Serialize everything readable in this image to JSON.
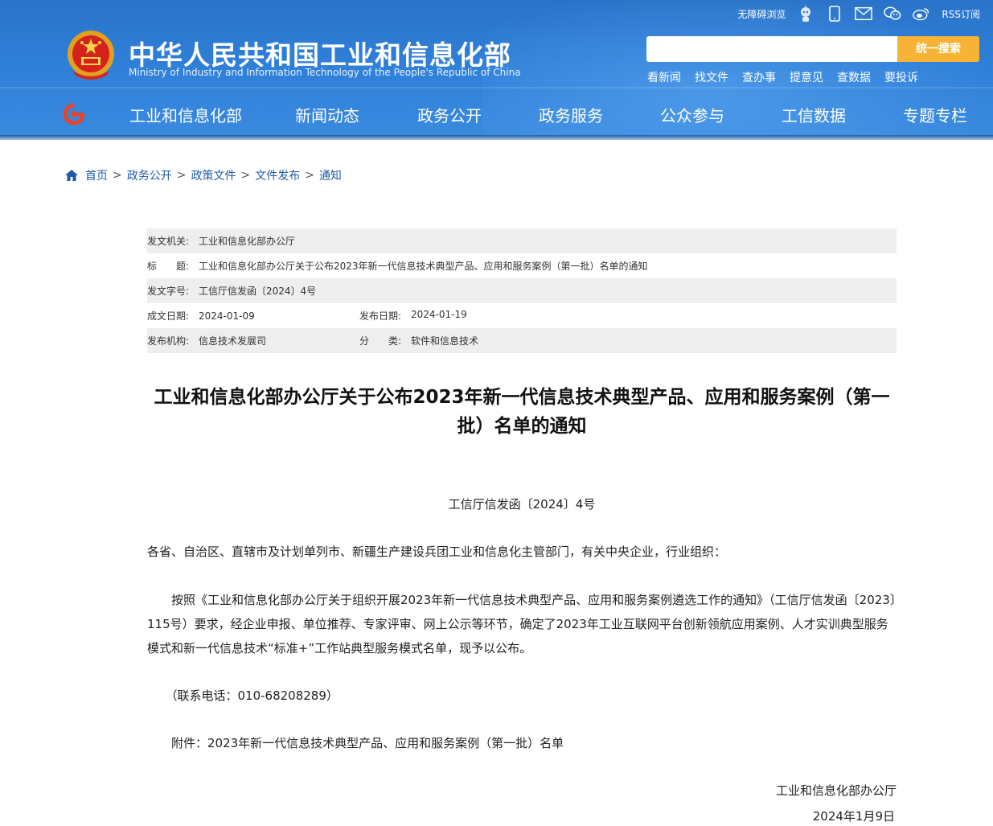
{
  "header": {
    "title": "中华人民共和国工业和信息化部",
    "subtitle": "Ministry of Industry and Information Technology of the People's Republic of China",
    "topbar": {
      "accessibility": "无障碍浏览",
      "rss": "RSS订阅"
    },
    "search": {
      "placeholder": "",
      "button": "统一搜索"
    },
    "quick_links": [
      "看新闻",
      "找文件",
      "查办事",
      "提意见",
      "查数据",
      "要投诉"
    ],
    "nav": [
      "工业和信息化部",
      "新闻动态",
      "政务公开",
      "政务服务",
      "公众参与",
      "工信数据",
      "专题专栏"
    ],
    "colors": {
      "header_blue": "#2f7fd8",
      "search_orange": "#f6b335",
      "link_blue": "#1e5aa8"
    }
  },
  "breadcrumb": [
    "首页",
    "政务公开",
    "政策文件",
    "文件发布",
    "通知"
  ],
  "meta": {
    "issuer_label": "发文机关:",
    "issuer": "工业和信息化部办公厅",
    "title_label": "标　　题:",
    "title": "工业和信息化部办公厅关于公布2023年新一代信息技术典型产品、应用和服务案例（第一批）名单的通知",
    "docno_label": "发文字号:",
    "docno": "工信厅信发函〔2024〕4号",
    "written_label": "成文日期:",
    "written": "2024-01-09",
    "published_label": "发布日期:",
    "published": "2024-01-19",
    "org_label": "发布机构:",
    "org": "信息技术发展司",
    "category_label": "分　　类:",
    "category": "软件和信息技术"
  },
  "article": {
    "title": "工业和信息化部办公厅关于公布2023年新一代信息技术典型产品、应用和服务案例（第一批）名单的通知",
    "doc_number": "工信厅信发函〔2024〕4号",
    "salutation": "各省、自治区、直辖市及计划单列市、新疆生产建设兵团工业和信息化主管部门，有关中央企业，行业组织：",
    "body": "　　按照《工业和信息化部办公厅关于组织开展2023年新一代信息技术典型产品、应用和服务案例遴选工作的通知》（工信厅信发函〔2023〕115号）要求，经企业申报、单位推荐、专家评审、网上公示等环节，确定了2023年工业互联网平台创新领航应用案例、人才实训典型服务模式和新一代信息技术“标准+”工作站典型服务模式名单，现予以公布。",
    "contact": "　　（联系电话：010-68208289）",
    "attachment": "　　附件：2023年新一代信息技术典型产品、应用和服务案例（第一批）名单",
    "signer": "工业和信息化部办公厅",
    "date": "2024年1月9日"
  }
}
